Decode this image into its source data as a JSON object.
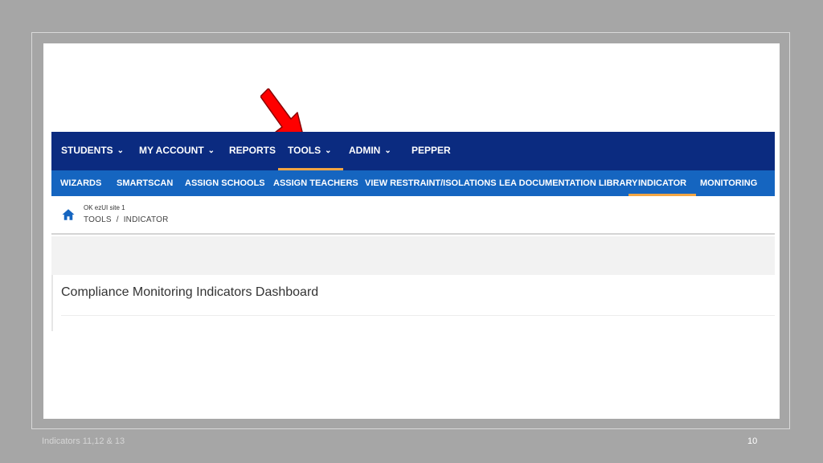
{
  "top_nav": {
    "items": [
      {
        "label": "STUDENTS",
        "dropdown": true
      },
      {
        "label": "MY ACCOUNT",
        "dropdown": true
      },
      {
        "label": "REPORTS",
        "dropdown": false
      },
      {
        "label": "TOOLS",
        "dropdown": true,
        "active": true
      },
      {
        "label": "ADMIN",
        "dropdown": true
      },
      {
        "label": "PEPPER",
        "dropdown": false
      }
    ],
    "chevron": "⌄"
  },
  "sub_nav": {
    "items": [
      {
        "label": "WIZARDS"
      },
      {
        "label": "SMARTSCAN"
      },
      {
        "label": "ASSIGN SCHOOLS"
      },
      {
        "label": "ASSIGN TEACHERS"
      },
      {
        "label": "VIEW RESTRAINT/ISOLATIONS"
      },
      {
        "label": "LEA DOCUMENTATION LIBRARY"
      },
      {
        "label": "INDICATOR",
        "active": true
      },
      {
        "label": "MONITORING"
      }
    ]
  },
  "breadcrumb": {
    "site": "OK ezUI site 1",
    "items": [
      "TOOLS",
      "INDICATOR"
    ],
    "separator": "/"
  },
  "page": {
    "title": "Compliance Monitoring Indicators Dashboard"
  },
  "slide": {
    "footer_text": "Indicators 11,12 & 13",
    "page_number": "10"
  },
  "colors": {
    "top_nav": "#0b2b80",
    "sub_nav": "#1565c0",
    "active_underline": "#f1a544",
    "annotation_arrow": "#ff0000"
  },
  "icons": {
    "home": "home-icon",
    "annotation": "red-arrow-icon"
  }
}
